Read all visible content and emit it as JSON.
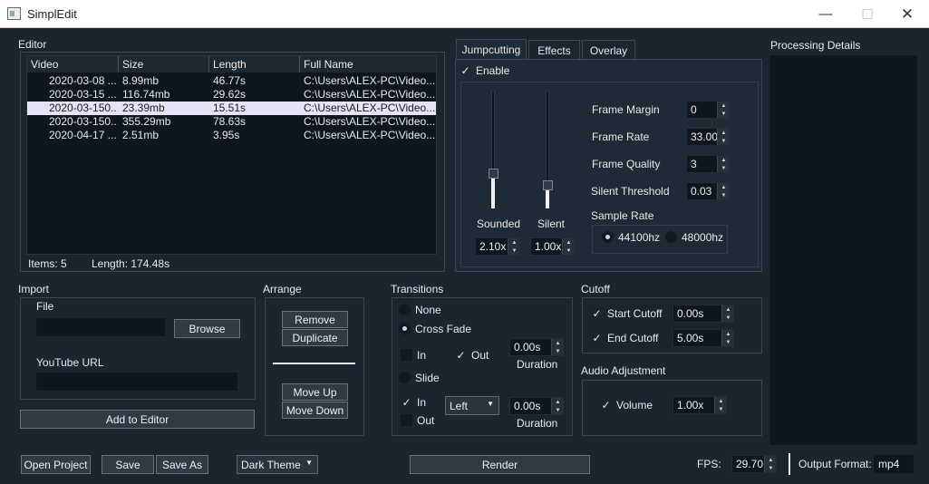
{
  "window": {
    "title": "SimplEdit",
    "icon": "app-window-icon",
    "minimize": "—",
    "maximize": "☐",
    "close": "✕"
  },
  "editor": {
    "label": "Editor",
    "columns": [
      "Video",
      "Size",
      "Length",
      "Full Name"
    ],
    "rows": [
      {
        "video": "2020-03-08 ...",
        "size": "8.99mb",
        "length": "46.77s",
        "full_name": "C:\\Users\\ALEX-PC\\Video..."
      },
      {
        "video": "2020-03-15 ...",
        "size": "116.74mb",
        "length": "29.62s",
        "full_name": "C:\\Users\\ALEX-PC\\Video..."
      },
      {
        "video": "2020-03-150...",
        "size": "23.39mb",
        "length": "15.51s",
        "full_name": "C:\\Users\\ALEX-PC\\Video..."
      },
      {
        "video": "2020-03-150...",
        "size": "355.29mb",
        "length": "78.63s",
        "full_name": "C:\\Users\\ALEX-PC\\Video..."
      },
      {
        "video": "2020-04-17 ...",
        "size": "2.51mb",
        "length": "3.95s",
        "full_name": "C:\\Users\\ALEX-PC\\Video..."
      }
    ],
    "selected_row": 2,
    "items": "Items: 5",
    "length": "Length: 174.48s"
  },
  "tabs": [
    "Jumpcutting",
    "Effects",
    "Overlay"
  ],
  "active_tab": "Jumpcutting",
  "jumpcutting": {
    "enable_check": "✓",
    "enable_label": "Enable",
    "sounded_label": "Sounded",
    "silent_label": "Silent",
    "sounded_value": "2.10x",
    "silent_value": "1.00x",
    "sounded_level": 0.28,
    "silent_level": 0.18,
    "frame_margin_label": "Frame Margin",
    "frame_margin": "0",
    "frame_rate_label": "Frame Rate",
    "frame_rate": "33.00",
    "frame_quality_label": "Frame Quality",
    "frame_quality": "3",
    "silent_threshold_label": "Silent Threshold",
    "silent_threshold": "0.03",
    "sample_rate_label": "Sample Rate",
    "sample_rate_options": [
      "44100hz",
      "48000hz"
    ],
    "sample_rate_selected": "44100hz"
  },
  "processing": {
    "label": "Processing Details"
  },
  "import": {
    "label": "Import",
    "file_label": "File",
    "browse": "Browse",
    "youtube_label": "YouTube URL",
    "add": "Add to Editor"
  },
  "arrange": {
    "label": "Arrange",
    "remove": "Remove",
    "duplicate": "Duplicate",
    "move_up": "Move Up",
    "move_down": "Move Down"
  },
  "transitions": {
    "label": "Transitions",
    "none": "None",
    "cross_fade": "Cross Fade",
    "selected": "Cross Fade",
    "cf_in": "In",
    "cf_out": "Out",
    "cf_duration": "0.00s",
    "duration_label": "Duration",
    "slide": "Slide",
    "slide_in": "In",
    "slide_out": "Out",
    "slide_direction": "Left",
    "slide_duration": "0.00s",
    "check_mark": "✓"
  },
  "cutoff": {
    "label": "Cutoff",
    "start_label": "Start Cutoff",
    "start_value": "0.00s",
    "end_label": "End Cutoff",
    "end_value": "5.00s"
  },
  "audio": {
    "label": "Audio Adjustment",
    "volume_label": "Volume",
    "volume_value": "1.00x"
  },
  "footer": {
    "open_project": "Open Project",
    "save": "Save",
    "save_as": "Save As",
    "theme": "Dark Theme",
    "render": "Render",
    "fps_label": "FPS:",
    "fps_value": "29.70",
    "output_label": "Output Format:",
    "output_value": "mp4"
  },
  "colors": {
    "background": "#1a2530",
    "field": "#0f171e",
    "selected_row": "#e6e3f7",
    "titlebar": "#ffffff"
  }
}
